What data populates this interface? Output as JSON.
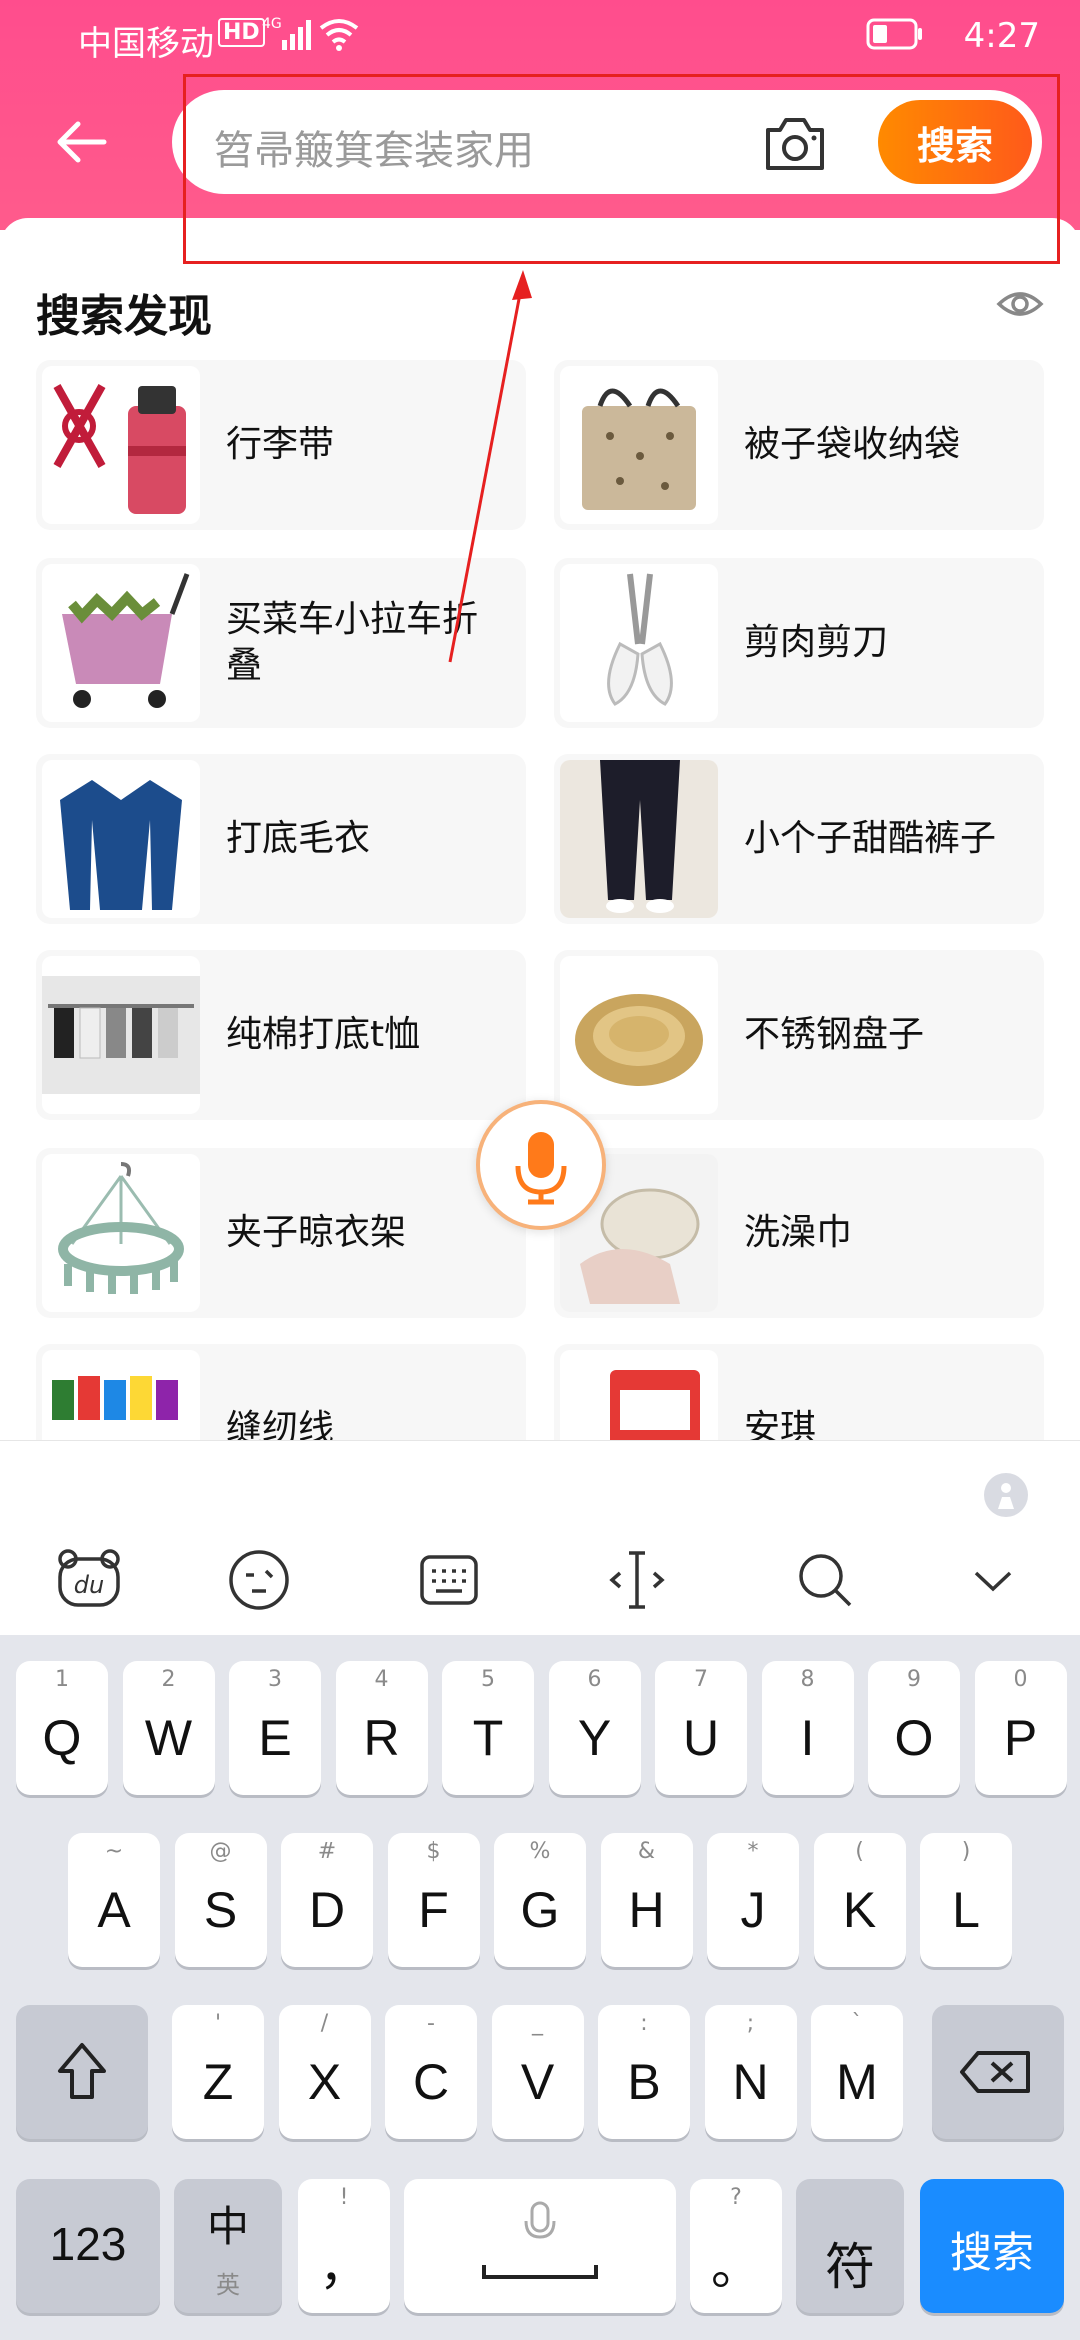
{
  "status": {
    "carrier": "中国移动",
    "network": "HD 4G",
    "time": "4:27"
  },
  "search": {
    "placeholder": "笤帚簸箕套装家用",
    "button": "搜索"
  },
  "discovery": {
    "title": "搜索发现",
    "items": [
      {
        "label": "行李带"
      },
      {
        "label": "被子袋收纳袋"
      },
      {
        "label": "买菜车小拉车折叠"
      },
      {
        "label": "剪肉剪刀"
      },
      {
        "label": "打底毛衣"
      },
      {
        "label": "小个子甜酷裤子"
      },
      {
        "label": "纯棉打底t恤"
      },
      {
        "label": "不锈钢盘子"
      },
      {
        "label": "夹子晾衣架"
      },
      {
        "label": "洗澡巾"
      },
      {
        "label": "缝纫线"
      },
      {
        "label": "安琪"
      }
    ]
  },
  "keyboard": {
    "row1": [
      {
        "sub": "1",
        "main": "Q"
      },
      {
        "sub": "2",
        "main": "W"
      },
      {
        "sub": "3",
        "main": "E"
      },
      {
        "sub": "4",
        "main": "R"
      },
      {
        "sub": "5",
        "main": "T"
      },
      {
        "sub": "6",
        "main": "Y"
      },
      {
        "sub": "7",
        "main": "U"
      },
      {
        "sub": "8",
        "main": "I"
      },
      {
        "sub": "9",
        "main": "O"
      },
      {
        "sub": "0",
        "main": "P"
      }
    ],
    "row2": [
      {
        "sub": "~",
        "main": "A"
      },
      {
        "sub": "@",
        "main": "S"
      },
      {
        "sub": "#",
        "main": "D"
      },
      {
        "sub": "$",
        "main": "F"
      },
      {
        "sub": "%",
        "main": "G"
      },
      {
        "sub": "&",
        "main": "H"
      },
      {
        "sub": "*",
        "main": "J"
      },
      {
        "sub": "(",
        "main": "K"
      },
      {
        "sub": ")",
        "main": "L"
      }
    ],
    "row3": [
      {
        "sub": "'",
        "main": "Z"
      },
      {
        "sub": "/",
        "main": "X"
      },
      {
        "sub": "-",
        "main": "C"
      },
      {
        "sub": "_",
        "main": "V"
      },
      {
        "sub": ":",
        "main": "B"
      },
      {
        "sub": ";",
        "main": "N"
      },
      {
        "sub": "`",
        "main": "M"
      }
    ],
    "num_label": "123",
    "lang_label": "中",
    "lang_sub": "英",
    "comma_sub": "!",
    "comma_main": "，",
    "period_sub": "?",
    "period_main": "。",
    "symbol_label": "符",
    "search_label": "搜索"
  },
  "colors": {
    "header": "#ff4d8d",
    "search_button": "#ff7a0a",
    "annotation": "#e62020",
    "keyboard_action": "#1a8cff"
  }
}
